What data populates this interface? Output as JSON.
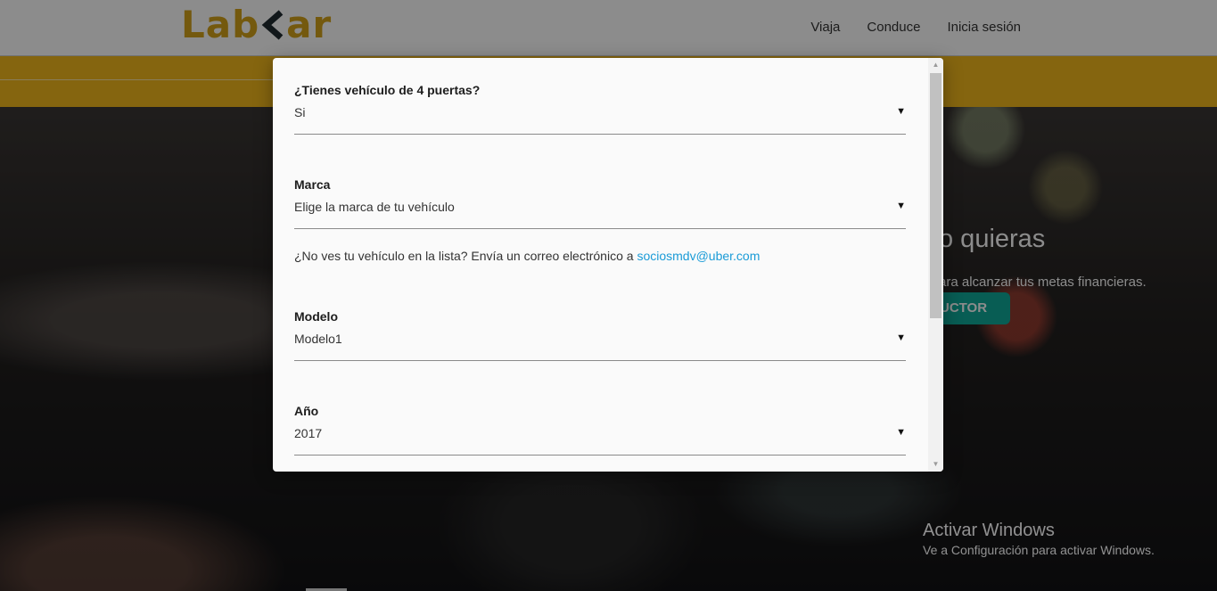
{
  "header": {
    "logo_left": "Lab",
    "logo_right": "ar",
    "nav": [
      "Viaja",
      "Conduce",
      "Inicia sesión"
    ]
  },
  "hero": {
    "title_fragment": "o quieras",
    "subtitle_fragment": "ara alcanzar tus metas financieras.",
    "button_fragment": "UCTOR"
  },
  "modal": {
    "fields": [
      {
        "label": "¿Tienes vehículo de 4 puertas?",
        "value": "Si"
      },
      {
        "label": "Marca",
        "value": "Elige la marca de tu vehículo"
      },
      {
        "label": "Modelo",
        "value": "Modelo1"
      },
      {
        "label": "Año",
        "value": "2017"
      }
    ],
    "help_text": "¿No ves tu vehículo en la lista? Envía un correo electrónico a",
    "help_email": "sociosmdv@uber.com",
    "dropdown_arrow": "▼",
    "scroll_up": "▲",
    "scroll_down": "▼"
  },
  "watermark": {
    "line1": "Activar Windows",
    "line2": "Ve a Configuración para activar Windows."
  },
  "colors": {
    "brand": "#d4a21a",
    "band": "#f3b81d",
    "link": "#1a9bd7",
    "cta": "#10a99a"
  }
}
